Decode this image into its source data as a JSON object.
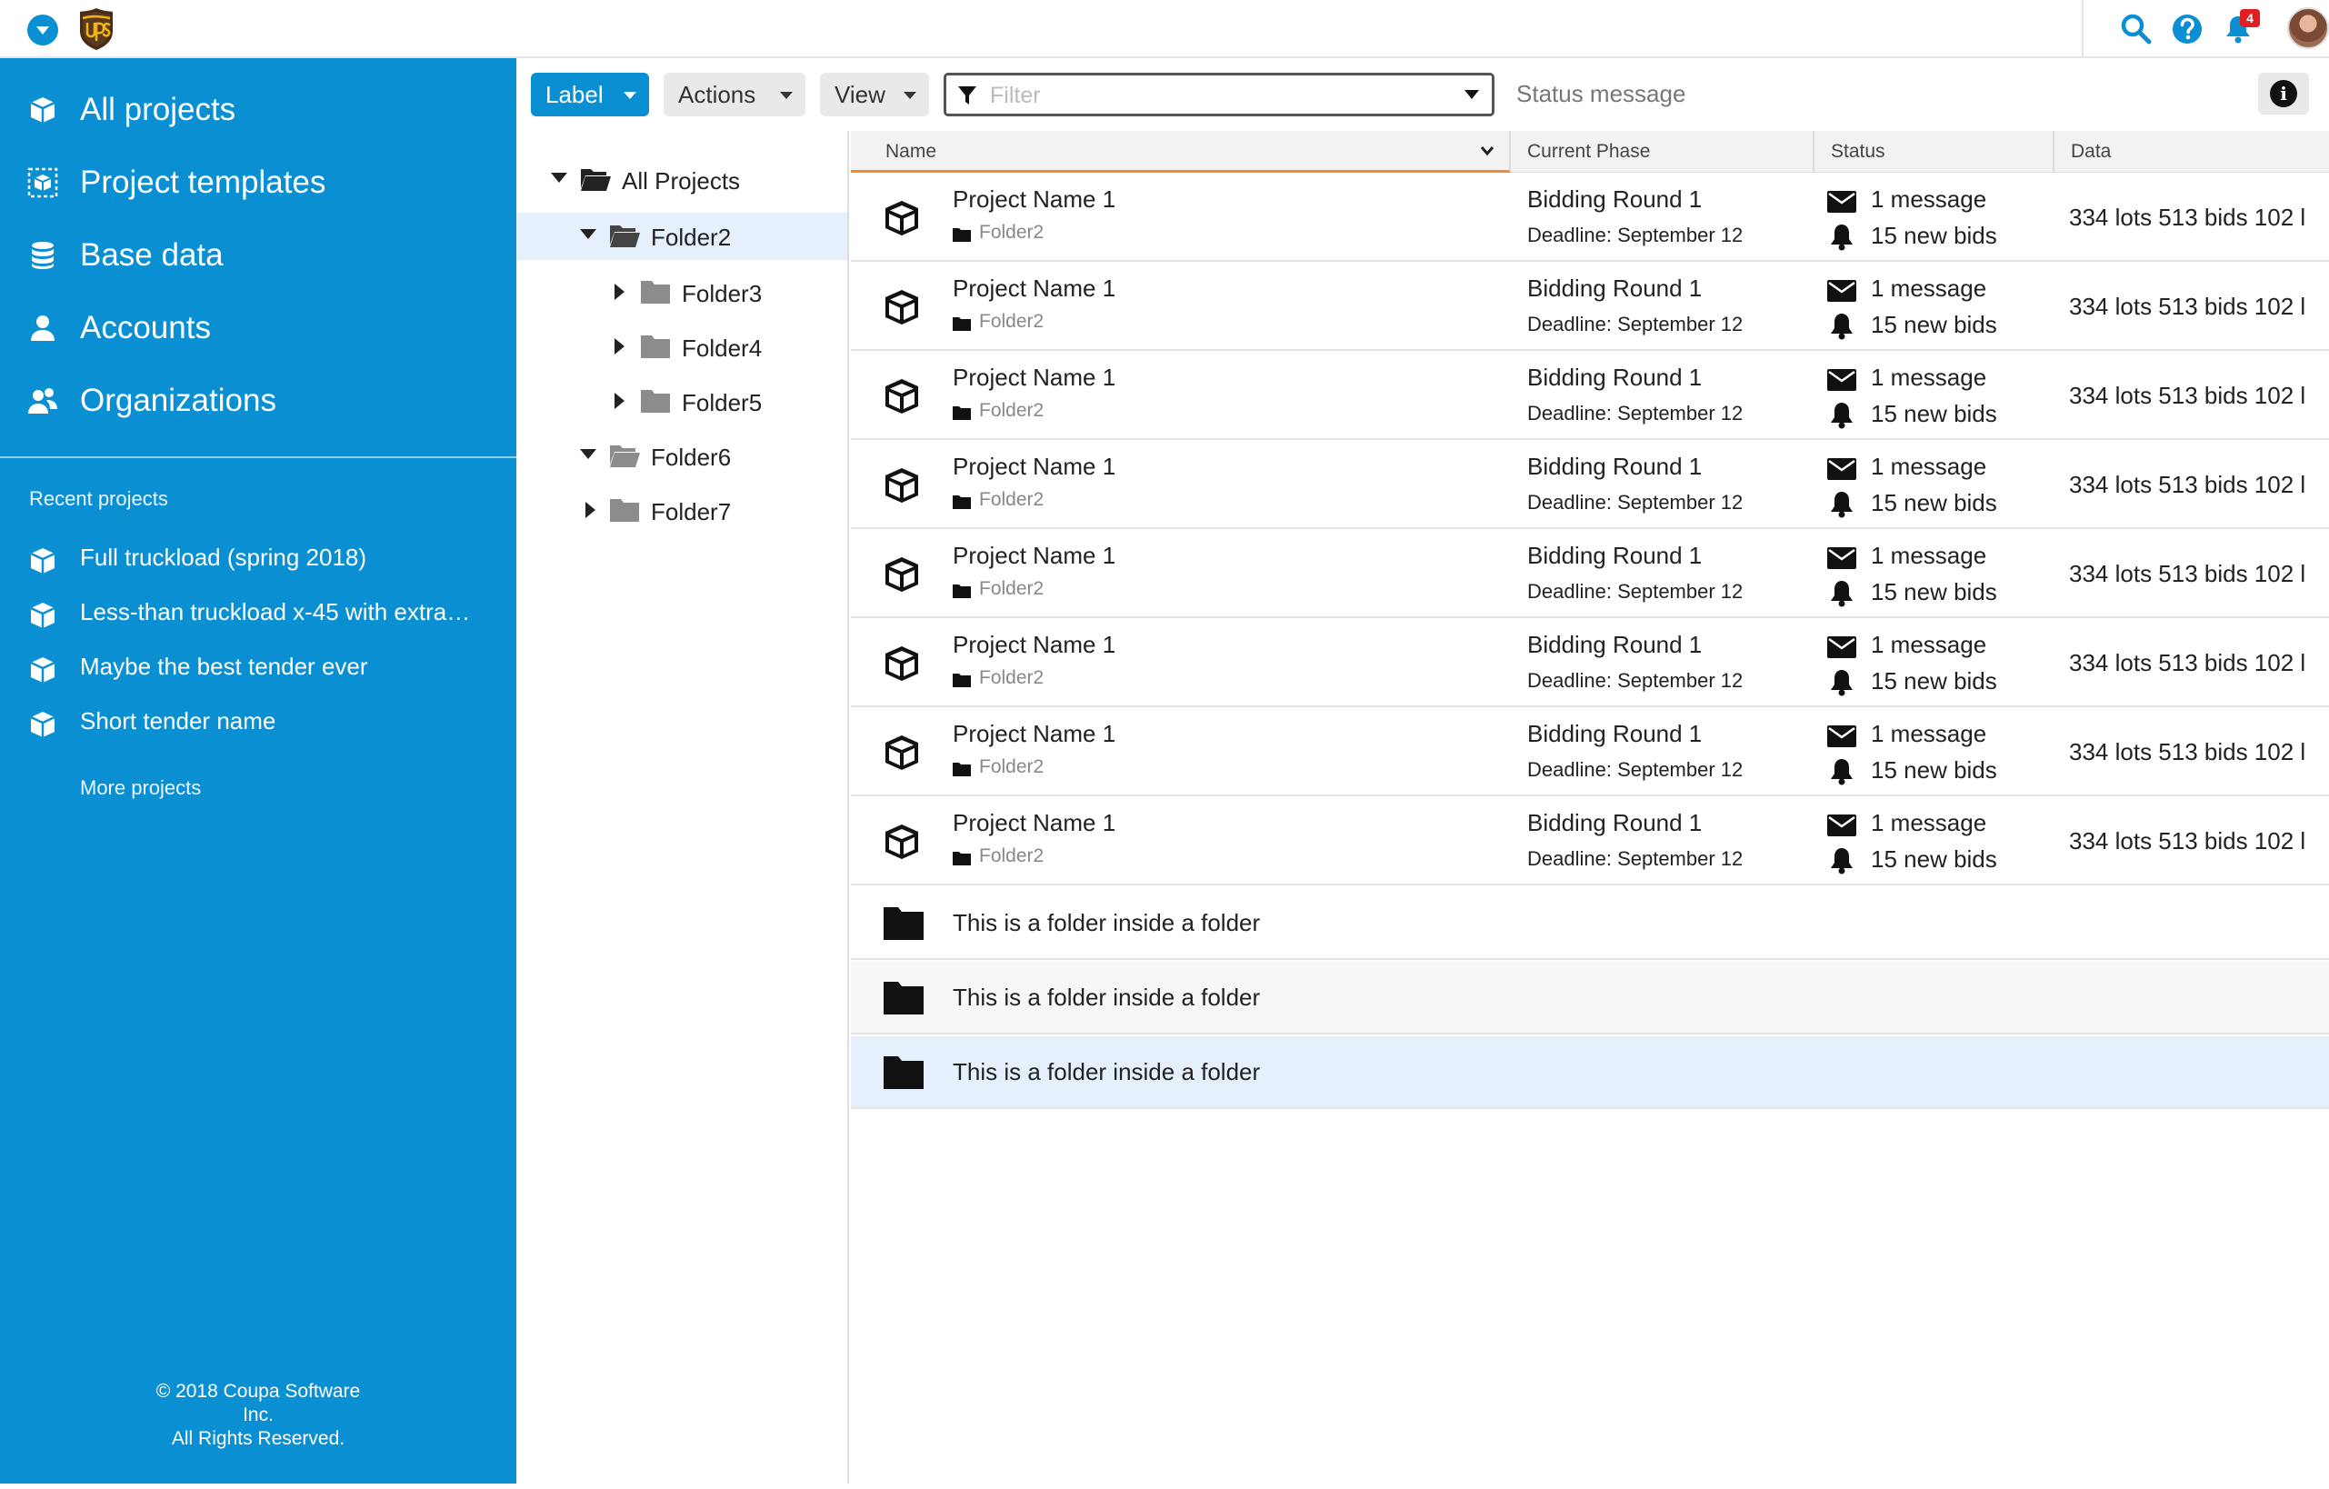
{
  "header": {
    "brand_logo": "UPS shield logo",
    "notification_count": "4",
    "icons": [
      "chevron-down-icon",
      "search-icon",
      "help-icon",
      "bell-icon",
      "avatar"
    ]
  },
  "sidebar": {
    "items": [
      {
        "label": "All projects",
        "icon": "cube-icon"
      },
      {
        "label": "Project templates",
        "icon": "template-icon"
      },
      {
        "label": "Base data",
        "icon": "database-icon"
      },
      {
        "label": "Accounts",
        "icon": "user-icon"
      },
      {
        "label": "Organizations",
        "icon": "users-icon"
      }
    ],
    "recent_title": "Recent projects",
    "recent": [
      "Full truckload (spring 2018)",
      "Less-than truckload x-45 with extra…",
      "Maybe the best tender ever",
      "Short tender name"
    ],
    "more_projects": "More projects",
    "copyright_line1": "© 2018 Coupa Software",
    "copyright_line2": "Inc.",
    "copyright_line3": "All Rights Reserved."
  },
  "toolbar": {
    "label_button": "Label",
    "actions_button": "Actions",
    "view_button": "View",
    "filter_placeholder": "Filter",
    "filter_value": "",
    "status_message": "Status message",
    "info_icon": "i"
  },
  "tree": {
    "root": "All Projects",
    "nodes": [
      "Folder2",
      "Folder3",
      "Folder4",
      "Folder5",
      "Folder6",
      "Folder7"
    ]
  },
  "grid": {
    "columns": {
      "name": "Name",
      "phase": "Current Phase",
      "status": "Status",
      "data": "Data"
    },
    "projects": [
      {
        "name": "Project Name 1",
        "folder": "Folder2",
        "phase": "Bidding Round 1",
        "deadline": "Deadline: September 12",
        "messages": "1 message",
        "bids": "15 new bids",
        "data": "334 lots  513 bids  102 l"
      },
      {
        "name": "Project Name 1",
        "folder": "Folder2",
        "phase": "Bidding Round 1",
        "deadline": "Deadline: September 12",
        "messages": "1 message",
        "bids": "15 new bids",
        "data": "334 lots  513 bids  102 l"
      },
      {
        "name": "Project Name 1",
        "folder": "Folder2",
        "phase": "Bidding Round 1",
        "deadline": "Deadline: September 12",
        "messages": "1 message",
        "bids": "15 new bids",
        "data": "334 lots  513 bids  102 l"
      },
      {
        "name": "Project Name 1",
        "folder": "Folder2",
        "phase": "Bidding Round 1",
        "deadline": "Deadline: September 12",
        "messages": "1 message",
        "bids": "15 new bids",
        "data": "334 lots  513 bids  102 l"
      },
      {
        "name": "Project Name 1",
        "folder": "Folder2",
        "phase": "Bidding Round 1",
        "deadline": "Deadline: September 12",
        "messages": "1 message",
        "bids": "15 new bids",
        "data": "334 lots  513 bids  102 l"
      },
      {
        "name": "Project Name 1",
        "folder": "Folder2",
        "phase": "Bidding Round 1",
        "deadline": "Deadline: September 12",
        "messages": "1 message",
        "bids": "15 new bids",
        "data": "334 lots  513 bids  102 l"
      },
      {
        "name": "Project Name 1",
        "folder": "Folder2",
        "phase": "Bidding Round 1",
        "deadline": "Deadline: September 12",
        "messages": "1 message",
        "bids": "15 new bids",
        "data": "334 lots  513 bids  102 l"
      },
      {
        "name": "Project Name 1",
        "folder": "Folder2",
        "phase": "Bidding Round 1",
        "deadline": "Deadline: September 12",
        "messages": "1 message",
        "bids": "15 new bids",
        "data": "334 lots  513 bids  102 l"
      }
    ],
    "folders": [
      "This is a folder inside a folder",
      "This is a folder inside a folder",
      "This is a folder inside a folder"
    ]
  },
  "colors": {
    "accent": "#0a8fd3",
    "sort_underline": "#f28b30",
    "selected_row": "#e5f0fc",
    "badge": "#e02020"
  }
}
